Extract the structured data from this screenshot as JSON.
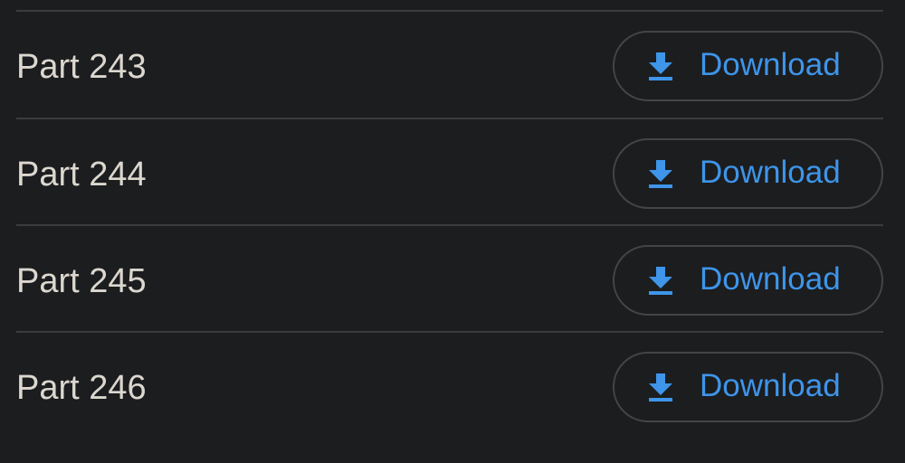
{
  "colors": {
    "background": "#1c1d1f",
    "divider": "#3b3c3e",
    "text": "#dcd7cf",
    "accent": "#3e95ea",
    "button_border": "#434548"
  },
  "items": [
    {
      "label": "Part 243",
      "button_label": "Download",
      "button_icon": "download-icon"
    },
    {
      "label": "Part 244",
      "button_label": "Download",
      "button_icon": "download-icon"
    },
    {
      "label": "Part 245",
      "button_label": "Download",
      "button_icon": "download-icon"
    },
    {
      "label": "Part 246",
      "button_label": "Download",
      "button_icon": "download-icon"
    }
  ]
}
